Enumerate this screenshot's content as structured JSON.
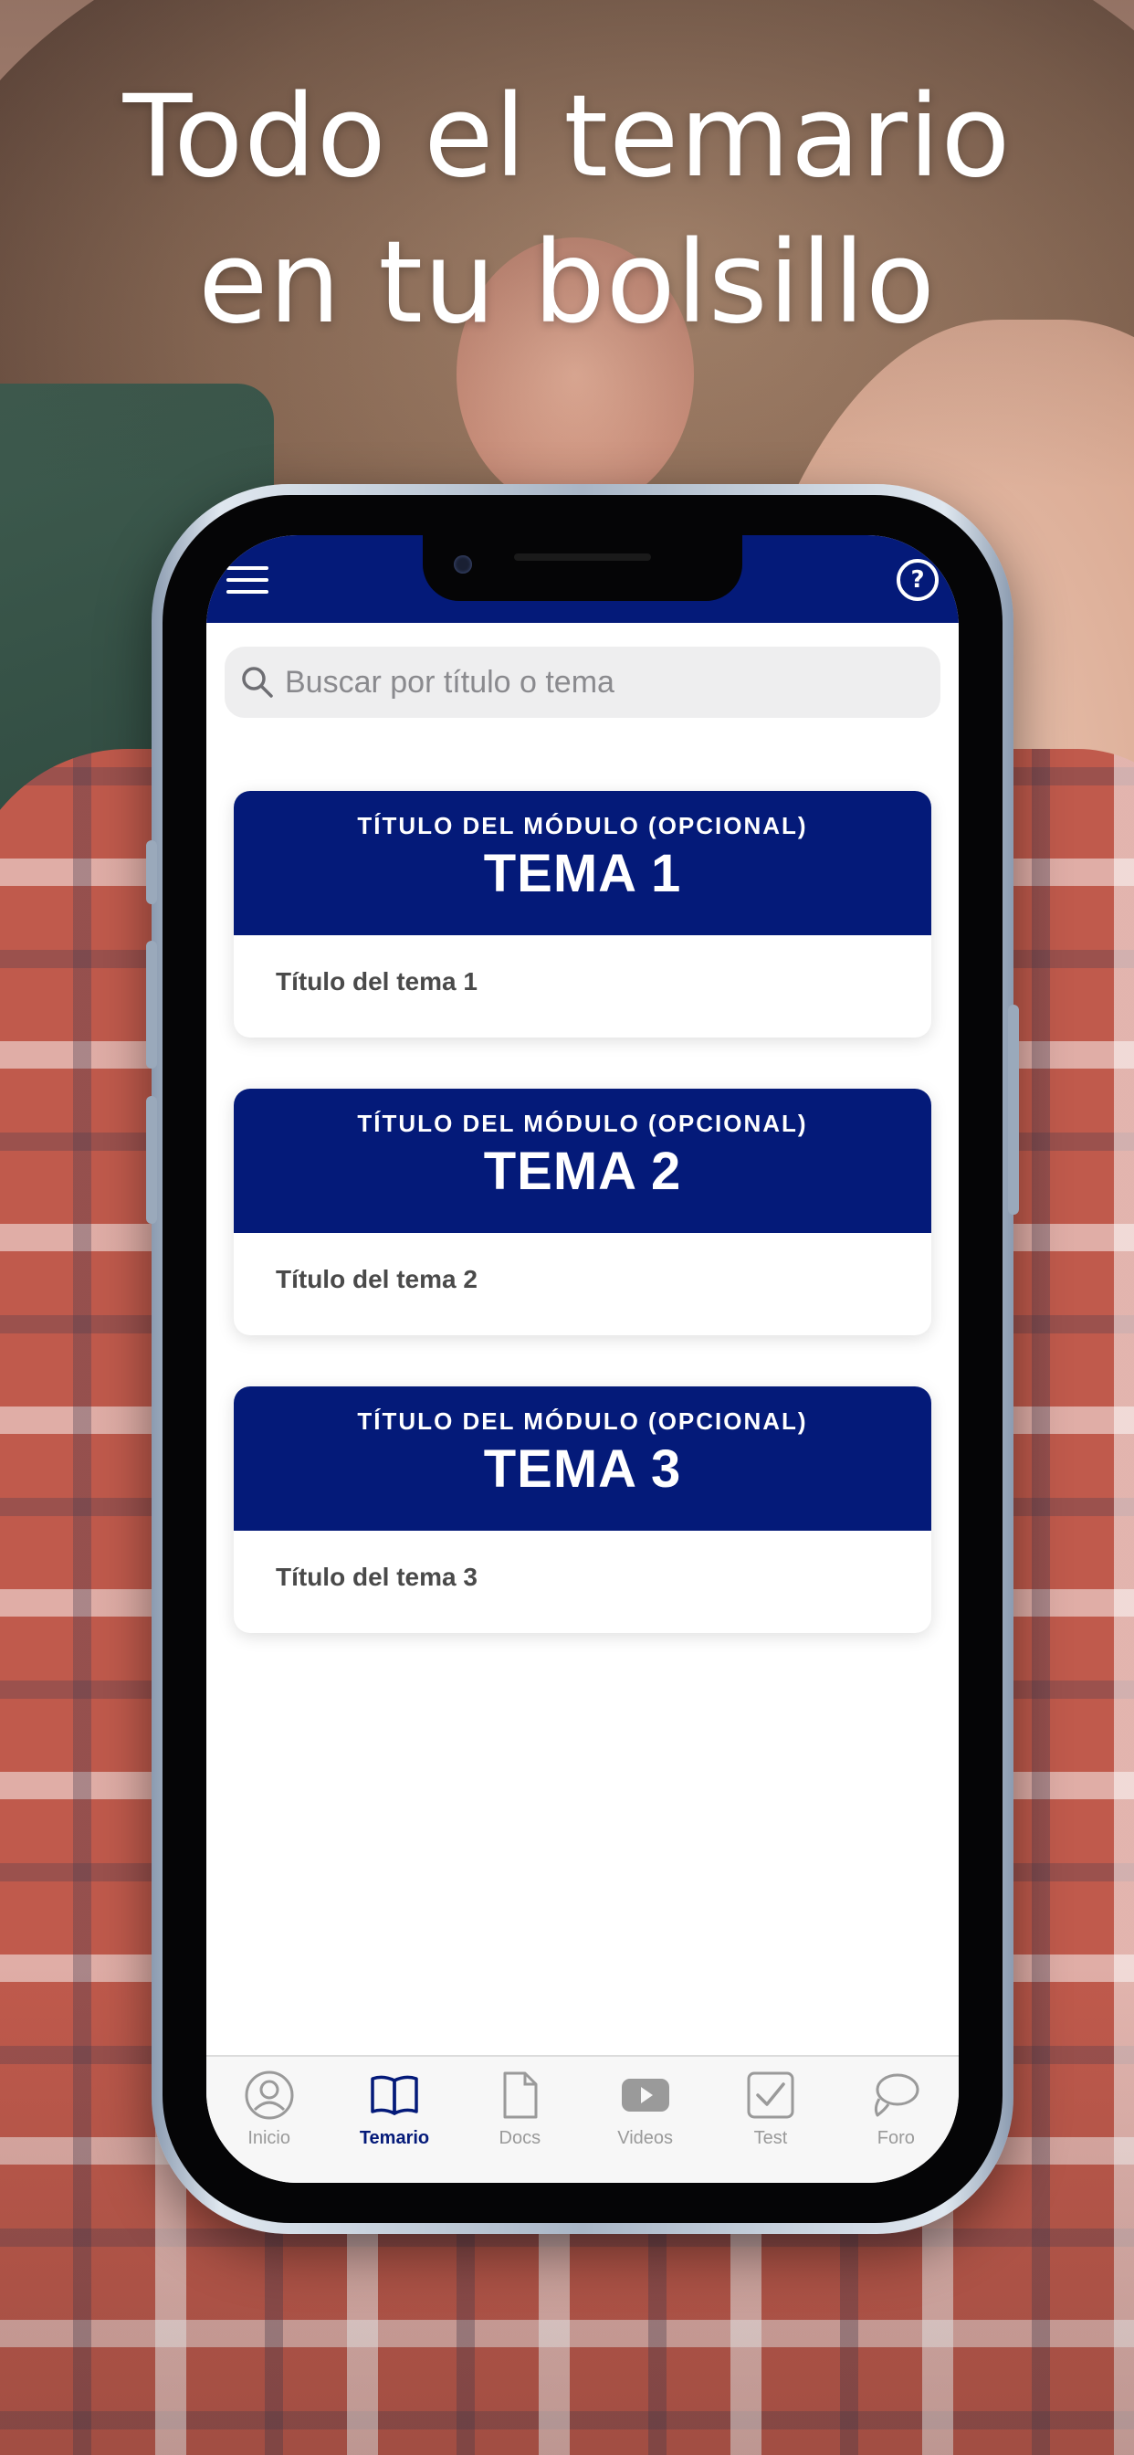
{
  "headline": {
    "line1": "Todo el temario",
    "line2": "en tu bolsillo"
  },
  "app": {
    "header": {
      "menu_icon": "hamburger-menu-icon",
      "help_icon": "question-circle-icon",
      "accent_color": "#041a79"
    },
    "search": {
      "placeholder": "Buscar por título o tema",
      "value": ""
    },
    "topics": [
      {
        "module": "TÍTULO DEL MÓDULO (OPCIONAL)",
        "tema": "TEMA 1",
        "title": "Título del tema 1"
      },
      {
        "module": "TÍTULO DEL MÓDULO (OPCIONAL)",
        "tema": "TEMA 2",
        "title": "Título del tema 2"
      },
      {
        "module": "TÍTULO DEL MÓDULO (OPCIONAL)",
        "tema": "TEMA 3",
        "title": "Título del tema 3"
      }
    ],
    "tabbar": {
      "tabs": [
        {
          "label": "Inicio",
          "icon": "user-circle-icon",
          "active": false
        },
        {
          "label": "Temario",
          "icon": "open-book-icon",
          "active": true
        },
        {
          "label": "Docs",
          "icon": "document-icon",
          "active": false
        },
        {
          "label": "Videos",
          "icon": "play-video-icon",
          "active": false
        },
        {
          "label": "Test",
          "icon": "checkbox-icon",
          "active": false
        },
        {
          "label": "Foro",
          "icon": "chat-bubbles-icon",
          "active": false
        }
      ]
    }
  }
}
